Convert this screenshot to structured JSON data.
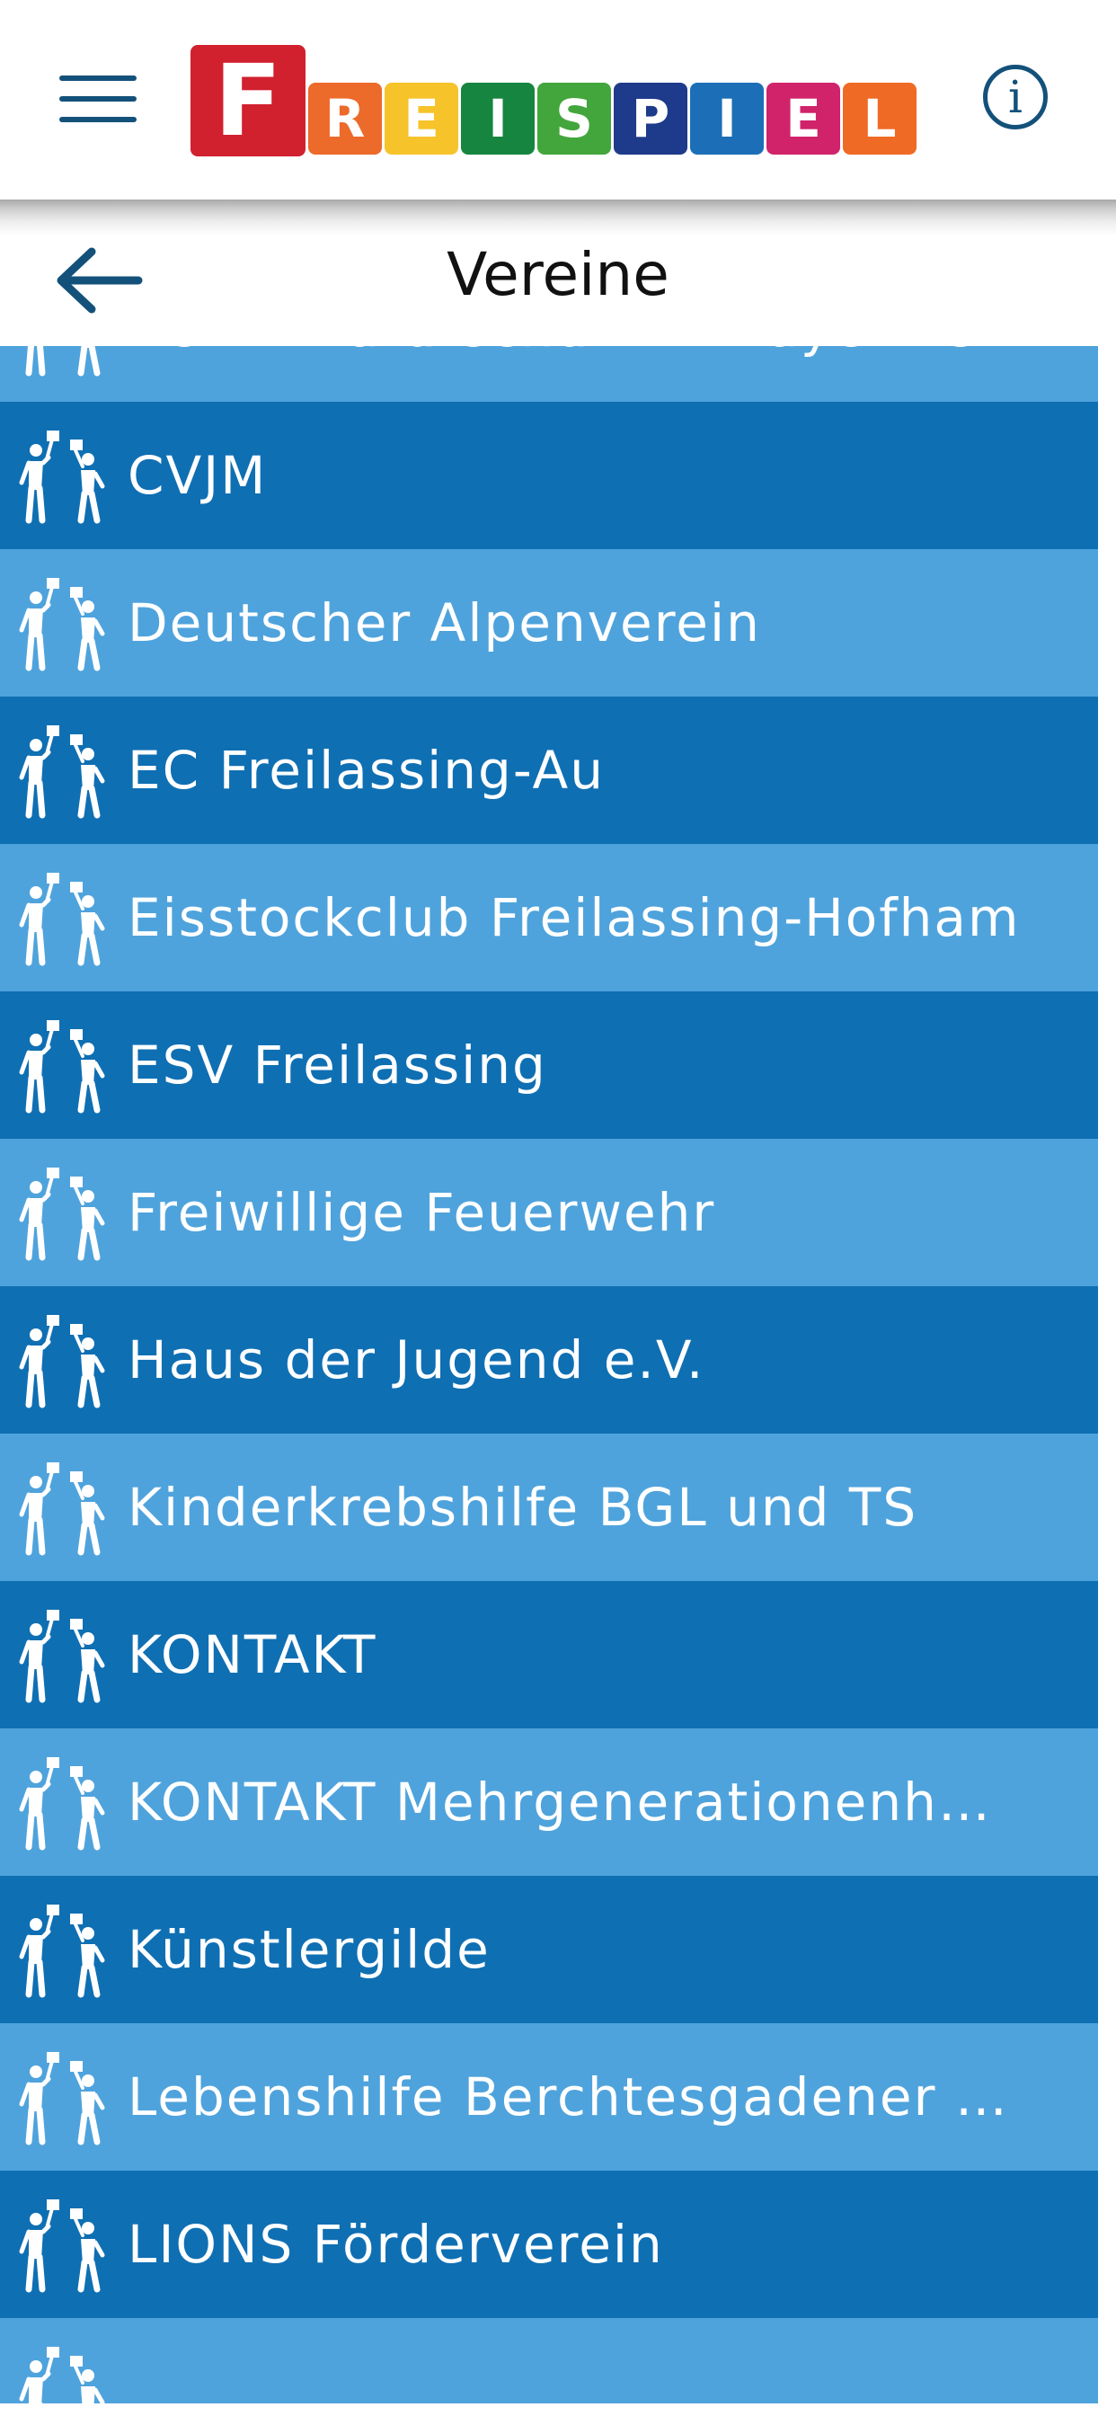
{
  "header": {
    "logo_letters": [
      "F",
      "R",
      "E",
      "I",
      "S",
      "P",
      "I",
      "E",
      "L"
    ],
    "logo_colors": [
      "#d1202e",
      "#ec6a2a",
      "#f6c32a",
      "#16853f",
      "#43a63c",
      "#1e3a8a",
      "#1c6fb7",
      "#d0236a",
      "#ef6a24"
    ],
    "info_symbol": "i",
    "accent_color": "#13517a"
  },
  "title": {
    "text": "Vereine"
  },
  "list": {
    "row_icon": "two-people-with-signs-icon",
    "light_color": "#4fa3dc",
    "dark_color": "#0f6fb3",
    "items": [
      "BUND Naturschutz in Bayern e.V.",
      "CVJM",
      "Deutscher Alpenverein",
      "EC Freilassing-Au",
      "Eisstockclub Freilassing-Hofham",
      "ESV Freilassing",
      "Freiwillige Feuerwehr",
      "Haus der Jugend e.V.",
      "Kinderkrebshilfe BGL und TS",
      "KONTAKT",
      "KONTAKT Mehrgenerationenh…",
      "Künstlergilde",
      "Lebenshilfe Berchtesgadener …",
      "LIONS Förderverein"
    ]
  }
}
